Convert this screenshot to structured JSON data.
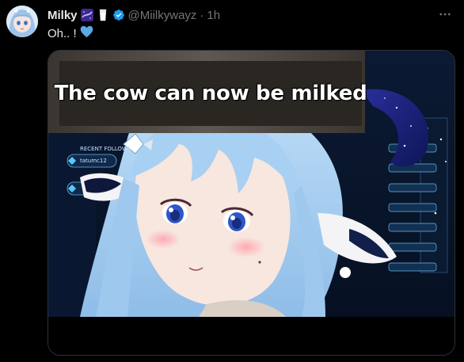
{
  "post": {
    "display_name": "Milky",
    "handle": "@Miilkywayz",
    "separator": "·",
    "timestamp": "1h",
    "text": "Oh.. !",
    "badges": [
      "galaxy-emoji",
      "milk-emoji",
      "verified-icon"
    ],
    "heart_color": "#5aa9e6",
    "verified_color": "#1d9bf0"
  },
  "media": {
    "caption": "The cow can now be milked",
    "hud_username": "tatumc12",
    "hud_recent_label": "RECENT FOLLOWS"
  },
  "colors": {
    "background": "#000000",
    "text_primary": "#e7e9ea",
    "text_secondary": "#71767b",
    "border": "#2f3336",
    "hair": "#a9cdef"
  }
}
